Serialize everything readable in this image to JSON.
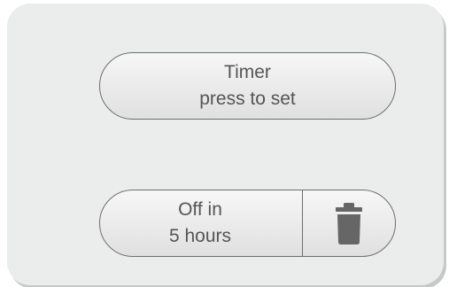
{
  "timer_button": {
    "line1": "Timer",
    "line2": "press to set"
  },
  "off_timer": {
    "line1": "Off in",
    "line2": "5 hours",
    "delete_icon": "trash-icon"
  },
  "colors": {
    "panel_bg": "#ebedec",
    "text": "#555555",
    "border": "#6e6e6e",
    "icon": "#666666"
  }
}
